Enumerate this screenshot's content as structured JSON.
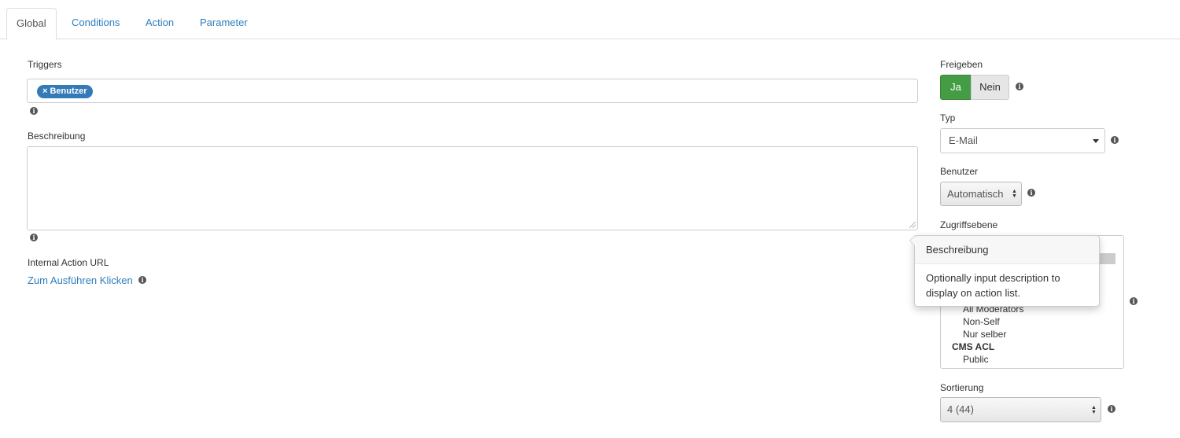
{
  "tabs": [
    {
      "label": "Global"
    },
    {
      "label": "Conditions"
    },
    {
      "label": "Action"
    },
    {
      "label": "Parameter"
    }
  ],
  "triggers": {
    "label": "Triggers",
    "chip": "× Benutzer"
  },
  "description": {
    "label": "Beschreibung",
    "value": ""
  },
  "internal_url": {
    "label": "Internal Action URL",
    "link": "Zum Ausführen Klicken"
  },
  "freigeben": {
    "label": "Freigeben",
    "yes": "Ja",
    "no": "Nein"
  },
  "typ": {
    "label": "Typ",
    "value": "E-Mail"
  },
  "benutzer": {
    "label": "Benutzer",
    "value": "Automatisch"
  },
  "zugriffsebene": {
    "label": "Zugriffsebene",
    "items": [
      "All Moderators",
      "Non-Self",
      "Nur selber"
    ],
    "group": "CMS ACL",
    "group_items": [
      "Public"
    ]
  },
  "sortierung": {
    "label": "Sortierung",
    "value": "4 (44)"
  },
  "popover": {
    "title": "Beschreibung",
    "body": "Optionally input description to display on action list."
  },
  "icons": {
    "info": "info-icon",
    "dropdown": "caret-down-icon",
    "updown": "updown-arrows-icon"
  },
  "colors": {
    "link": "#2e7ebd",
    "chip": "#337ab7",
    "toggle_on": "#449d44"
  }
}
